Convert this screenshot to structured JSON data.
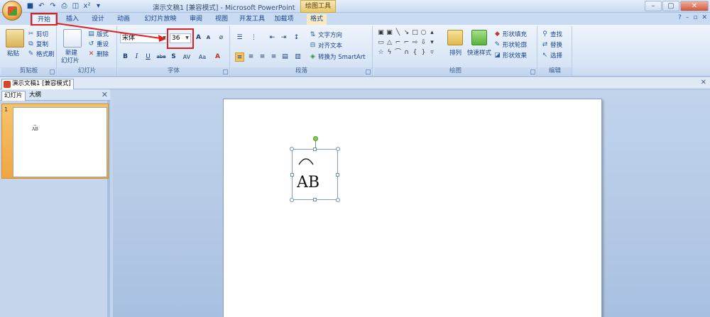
{
  "title_bar": {
    "window_title": "演示文稿1 [兼容模式] - Microsoft PowerPoint",
    "contextual_tab": "绘图工具",
    "quick_access": [
      "save-icon",
      "undo-icon",
      "redo-icon",
      "print-icon",
      "preview-icon",
      "format-icon",
      "customize-icon"
    ],
    "window_buttons": [
      "–",
      "▢",
      "✕"
    ]
  },
  "tabs": [
    "开始",
    "插入",
    "设计",
    "动画",
    "幻灯片放映",
    "审阅",
    "视图",
    "开发工具",
    "加载项",
    "格式"
  ],
  "active_tab": "开始",
  "ribbon": {
    "clipboard": {
      "label": "剪贴板",
      "paste": "粘贴",
      "cut": "剪切",
      "copy": "复制",
      "format_painter": "格式刷"
    },
    "slides": {
      "label": "幻灯片",
      "new_slide_1": "新建",
      "new_slide_2": "幻灯片",
      "layout": "版式",
      "reset": "重设",
      "delete": "删除"
    },
    "font": {
      "label": "字体",
      "font_name": "宋体",
      "font_size": "36",
      "bold": "B",
      "italic": "I",
      "underline": "U",
      "strike": "abe",
      "shadow": "S",
      "spacing": "AV",
      "case": "Aa",
      "grow": "A",
      "shrink": "A"
    },
    "paragraph": {
      "label": "段落",
      "text_direction": "文字方向",
      "align_text": "对齐文本",
      "smartart": "转换为 SmartArt"
    },
    "drawing": {
      "label": "绘图",
      "arrange": "排列",
      "quick_styles": "快速样式",
      "shape_fill": "形状填充",
      "shape_outline": "形状轮廓",
      "shape_effects": "形状效果"
    },
    "editing": {
      "label": "编辑",
      "find": "查找",
      "replace": "替换",
      "select": "选择"
    }
  },
  "document_tab": "演示文稿1 [兼容模式]",
  "panel": {
    "tab_slides": "幻灯片",
    "tab_outline": "大纲",
    "slide_number": "1",
    "thumb_arc": "⌢",
    "thumb_text": "AB"
  },
  "slide": {
    "text": "AB"
  },
  "colors": {
    "annotation": "#e02020",
    "rotation_handle": "#7fd04b"
  }
}
